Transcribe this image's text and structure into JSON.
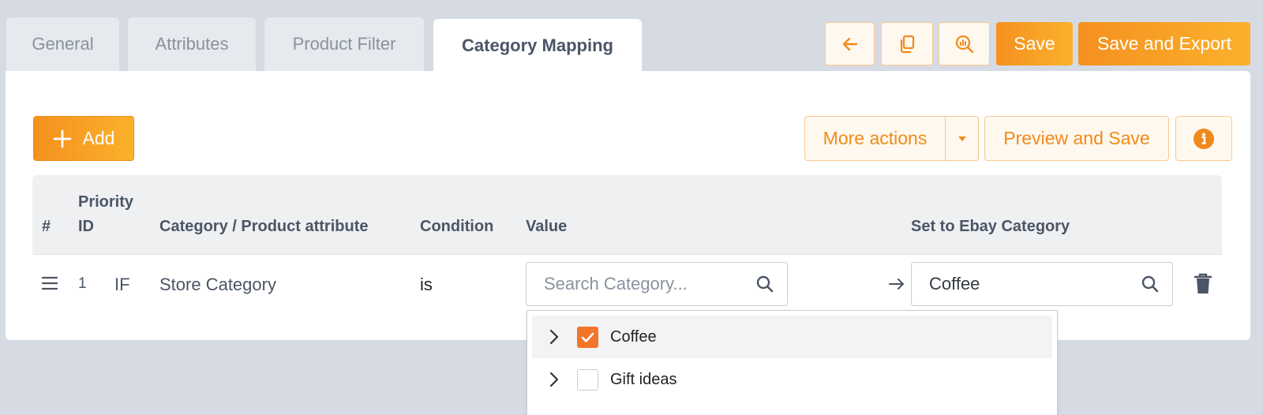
{
  "tabs": [
    {
      "label": "General",
      "active": false
    },
    {
      "label": "Attributes",
      "active": false
    },
    {
      "label": "Product Filter",
      "active": false
    },
    {
      "label": "Category Mapping",
      "active": true
    }
  ],
  "toolbar": {
    "back_icon": "arrow-left-icon",
    "copy_icon": "copy-icon",
    "preview_icon": "search-chart-icon",
    "save_label": "Save",
    "save_export_label": "Save and Export"
  },
  "actions": {
    "add_label": "Add",
    "more_actions_label": "More actions",
    "preview_save_label": "Preview and Save",
    "info_icon": "info-icon"
  },
  "table": {
    "headers": {
      "hash": "#",
      "priority_line1": "Priority",
      "priority_line2": "ID",
      "category": "Category / Product attribute",
      "condition": "Condition",
      "value": "Value",
      "set_to": "Set to Ebay Category"
    },
    "rows": [
      {
        "priority": "1",
        "if": "IF",
        "category": "Store Category",
        "condition": "is",
        "value_placeholder": "Search Category...",
        "set_to_value": "Coffee"
      }
    ]
  },
  "dropdown": {
    "items": [
      {
        "label": "Coffee",
        "checked": true
      },
      {
        "label": "Gift ideas",
        "checked": false
      }
    ]
  },
  "colors": {
    "accent": "#f5901f",
    "checkbox": "#f2752a",
    "background": "#d6dbe3"
  }
}
